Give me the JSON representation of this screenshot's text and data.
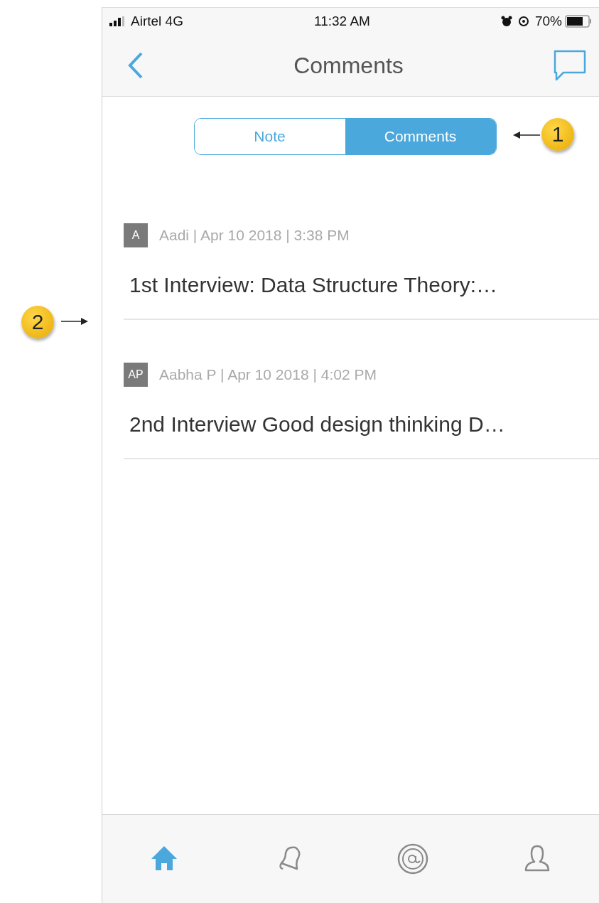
{
  "status_bar": {
    "carrier": "Airtel 4G",
    "time": "11:32 AM",
    "battery": "70%"
  },
  "header": {
    "title": "Comments"
  },
  "segments": [
    {
      "label": "Note",
      "selected": false
    },
    {
      "label": "Comments",
      "selected": true
    }
  ],
  "comments": [
    {
      "initials": "A",
      "meta": "Aadi | Apr 10 2018 | 3:38 PM",
      "text": "1st Interview: Data Structure Theory:…"
    },
    {
      "initials": "AP",
      "meta": "Aabha P | Apr 10 2018 | 4:02 PM",
      "text": "2nd Interview Good design thinking D…"
    }
  ],
  "tab_bar": [
    {
      "kind": "home",
      "selected": true
    },
    {
      "kind": "bell",
      "selected": false
    },
    {
      "kind": "at",
      "selected": false
    },
    {
      "kind": "person",
      "selected": false
    }
  ],
  "callouts": [
    {
      "number": "1",
      "kind": "left"
    },
    {
      "number": "2",
      "kind": "right"
    }
  ]
}
